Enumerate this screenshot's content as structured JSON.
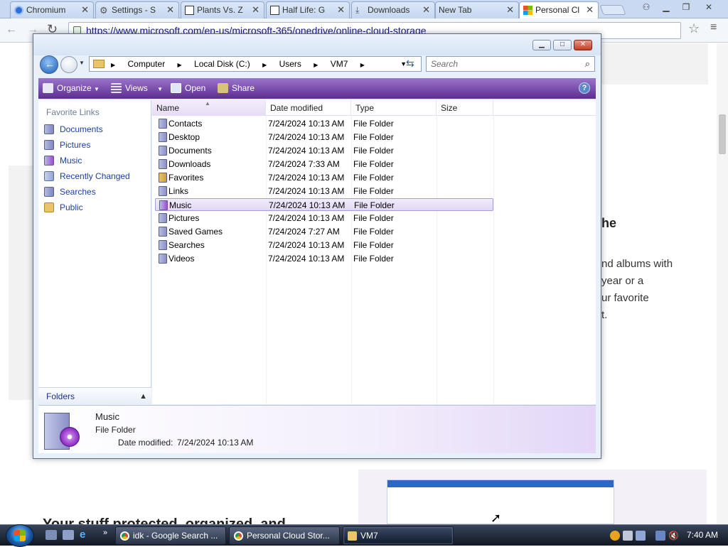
{
  "browser": {
    "tabs": [
      {
        "label": "Chromium",
        "icon": "chromium-icon"
      },
      {
        "label": "Settings - S",
        "icon": "gear-icon"
      },
      {
        "label": "Plants Vs. Z",
        "icon": "wiki-icon"
      },
      {
        "label": "Half Life: G",
        "icon": "wiki-icon"
      },
      {
        "label": "Downloads",
        "icon": "download-icon"
      },
      {
        "label": "New Tab",
        "icon": ""
      },
      {
        "label": "Personal Cl",
        "icon": "microsoft-icon"
      }
    ],
    "address": "https://www.microsoft.com/en-us/microsoft-365/onedrive/online-cloud-storage"
  },
  "page": {
    "heading_fragment": "he",
    "body_lines": [
      "nd albums with",
      "year or a",
      "ur favorite",
      "t."
    ],
    "footer_heading": "Your stuff protected, organized, and"
  },
  "explorer": {
    "breadcrumb": [
      "Computer",
      "Local Disk (C:)",
      "Users",
      "VM7"
    ],
    "search_placeholder": "Search",
    "commands": {
      "organize": "Organize",
      "views": "Views",
      "open": "Open",
      "share": "Share"
    },
    "nav_header": "Favorite Links",
    "nav_items": [
      "Documents",
      "Pictures",
      "Music",
      "Recently Changed",
      "Searches",
      "Public"
    ],
    "folders_label": "Folders",
    "columns": [
      "Name",
      "Date modified",
      "Type",
      "Size"
    ],
    "rows": [
      {
        "name": "Contacts",
        "date": "7/24/2024 10:13 AM",
        "type": "File Folder"
      },
      {
        "name": "Desktop",
        "date": "7/24/2024 10:13 AM",
        "type": "File Folder"
      },
      {
        "name": "Documents",
        "date": "7/24/2024 10:13 AM",
        "type": "File Folder"
      },
      {
        "name": "Downloads",
        "date": "7/24/2024 7:33 AM",
        "type": "File Folder"
      },
      {
        "name": "Favorites",
        "date": "7/24/2024 10:13 AM",
        "type": "File Folder"
      },
      {
        "name": "Links",
        "date": "7/24/2024 10:13 AM",
        "type": "File Folder"
      },
      {
        "name": "Music",
        "date": "7/24/2024 10:13 AM",
        "type": "File Folder"
      },
      {
        "name": "Pictures",
        "date": "7/24/2024 10:13 AM",
        "type": "File Folder"
      },
      {
        "name": "Saved Games",
        "date": "7/24/2024 7:27 AM",
        "type": "File Folder"
      },
      {
        "name": "Searches",
        "date": "7/24/2024 10:13 AM",
        "type": "File Folder"
      },
      {
        "name": "Videos",
        "date": "7/24/2024 10:13 AM",
        "type": "File Folder"
      }
    ],
    "selected_row": "Music",
    "details": {
      "name": "Music",
      "type": "File Folder",
      "date_label": "Date modified:",
      "date_value": "7/24/2024 10:13 AM"
    }
  },
  "taskbar": {
    "buttons": [
      "idk - Google Search ...",
      "Personal Cloud Stor...",
      "VM7"
    ],
    "clock": "7:40 AM"
  },
  "colors": {
    "accent_purple": "#5c2d8f",
    "selection": "#e2d8f5",
    "link_blue": "#1d3fa0"
  }
}
